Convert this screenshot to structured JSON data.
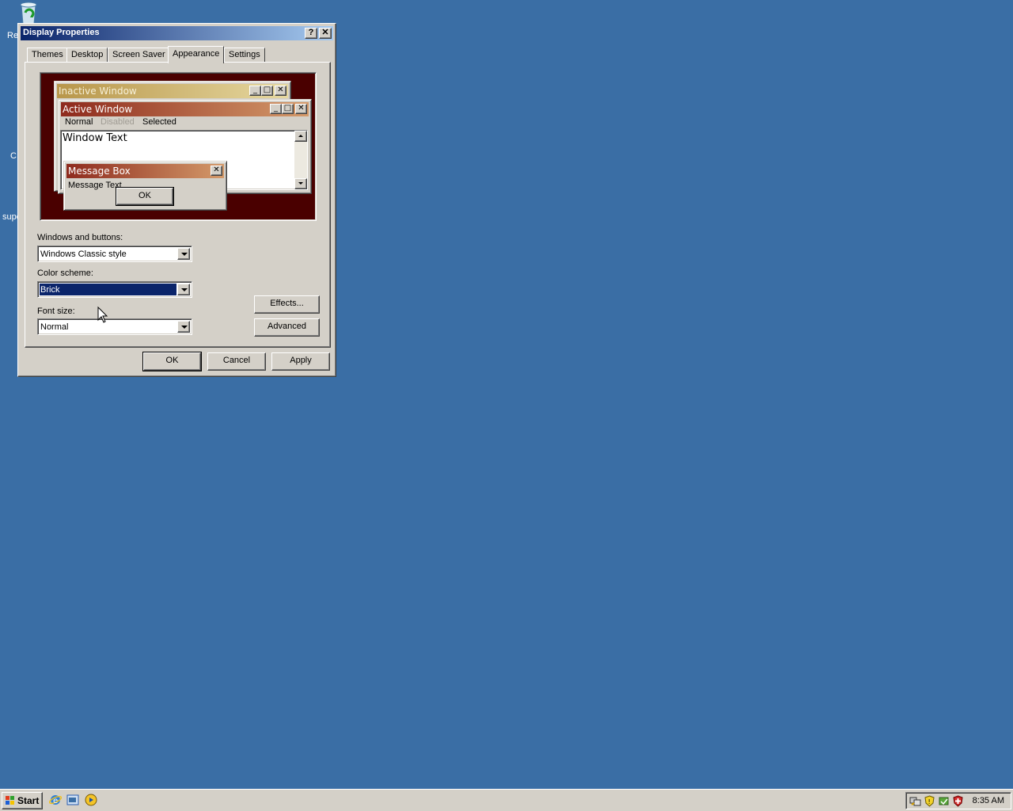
{
  "desktop": {
    "icons": [
      {
        "label": "Re",
        "icon": "recycle-bin-icon"
      },
      {
        "label": "C",
        "icon": ""
      },
      {
        "label": "supe",
        "icon": ""
      }
    ]
  },
  "dialog": {
    "title": "Display Properties",
    "help_btn": "?",
    "close_btn": "✕",
    "tabs": [
      {
        "label": "Themes"
      },
      {
        "label": "Desktop"
      },
      {
        "label": "Screen Saver"
      },
      {
        "label": "Appearance",
        "active": true
      },
      {
        "label": "Settings"
      }
    ],
    "preview": {
      "inactive_title": "Inactive Window",
      "active_title": "Active Window",
      "menu": {
        "normal": "Normal",
        "disabled": "Disabled",
        "selected": "Selected"
      },
      "window_text": "Window Text",
      "msgbox_title": "Message Box",
      "msgbox_text": "Message Text",
      "msgbox_ok": "OK"
    },
    "windows_buttons": {
      "label": "Windows and buttons:",
      "value": "Windows Classic style"
    },
    "color_scheme": {
      "label": "Color scheme:",
      "value": "Brick"
    },
    "font_size": {
      "label": "Font size:",
      "value": "Normal"
    },
    "effects_btn": "Effects...",
    "advanced_btn": "Advanced",
    "ok_btn": "OK",
    "cancel_btn": "Cancel",
    "apply_btn": "Apply"
  },
  "taskbar": {
    "start_label": "Start",
    "quick_launch": [
      "internet-explorer-icon",
      "show-desktop-icon",
      "media-player-icon"
    ],
    "tray_icons": [
      "network-icon",
      "security-shield-icon",
      "update-icon",
      "antivirus-icon"
    ],
    "clock": "8:35 AM"
  },
  "colors": {
    "desktop": "#3a6ea5",
    "face": "#d4d0c8",
    "active_caption": "#0a246a",
    "brick_dark": "#4a0000",
    "brick_active": "#8e2a1d",
    "brick_inactive": "#c0a85c"
  }
}
